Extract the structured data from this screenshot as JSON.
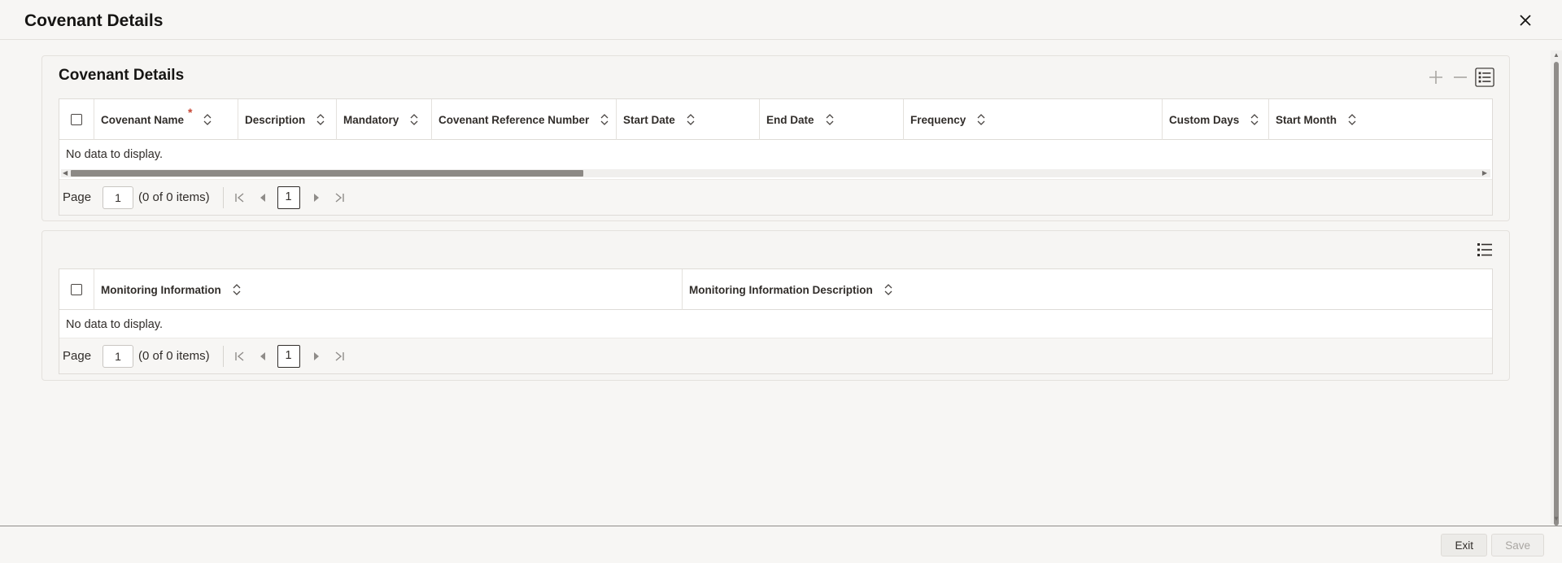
{
  "window": {
    "title": "Covenant Details",
    "close_icon": "close-icon"
  },
  "covenant_panel": {
    "title": "Covenant Details",
    "toolbar": {
      "add_icon": "plus-icon",
      "remove_icon": "minus-icon",
      "columns_icon": "list-icon"
    },
    "columns": [
      {
        "label": "Covenant Name",
        "required_marker": "*"
      },
      {
        "label": "Description"
      },
      {
        "label": "Mandatory"
      },
      {
        "label": "Covenant Reference Number"
      },
      {
        "label": "Start Date"
      },
      {
        "label": "End Date"
      },
      {
        "label": "Frequency"
      },
      {
        "label": "Custom Days"
      },
      {
        "label": "Start Month"
      }
    ],
    "empty_text": "No data to display.",
    "pager": {
      "page_label": "Page",
      "page_value": "1",
      "items_text": "(0 of 0 items)",
      "current_page": "1"
    }
  },
  "monitoring_panel": {
    "toolbar": {
      "columns_icon": "list-icon"
    },
    "columns": [
      {
        "label": "Monitoring Information"
      },
      {
        "label": "Monitoring Information Description"
      }
    ],
    "empty_text": "No data to display.",
    "pager": {
      "page_label": "Page",
      "page_value": "1",
      "items_text": "(0 of 0 items)",
      "current_page": "1"
    }
  },
  "footer": {
    "exit_label": "Exit",
    "save_label": "Save"
  },
  "colors": {
    "background": "#f7f6f4",
    "required": "#c74634",
    "text": "#161513"
  }
}
